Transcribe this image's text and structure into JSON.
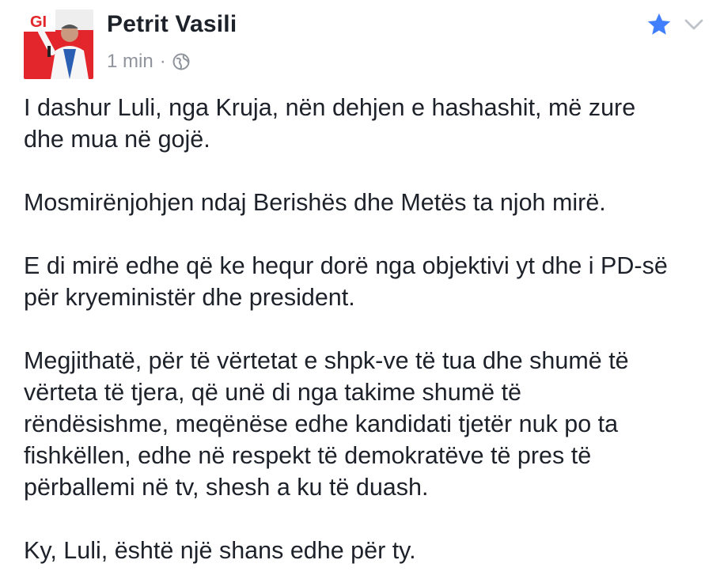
{
  "post": {
    "author": "Petrit Vasili",
    "time": "1 min",
    "separator": "·",
    "privacy_icon": "globe-icon",
    "favorite_icon": "star-icon",
    "menu_icon": "chevron-down-icon",
    "avatar_sign_text": "GI",
    "paragraphs": [
      "I dashur Luli, nga Kruja, nën dehjen e hashashit, më zure\ndhe mua në gojë.",
      "Mosmirënjohjen ndaj Berishës dhe Metës ta njoh mirë.",
      "E di mirë edhe që ke hequr dorë nga objektivi yt dhe i PD-së\npër kryeministër dhe president.",
      "Megjithatë, për të vërtetat e shpk-ve të tua dhe shumë të\nvërteta të tjera, që unë di nga takime shumë të\nrëndësishme, meqënëse edhe kandidati tjetër nuk po ta\nfishkëllen, edhe në respekt të demokratëve të pres të\npërballemi në tv, shesh a ku të duash.",
      "Ky, Luli, është një shans edhe për ty."
    ]
  },
  "colors": {
    "text": "#1d2129",
    "meta": "#90949c",
    "star": "#4080ff",
    "chevron": "#bec2c9",
    "brand_red": "#e3262b"
  }
}
